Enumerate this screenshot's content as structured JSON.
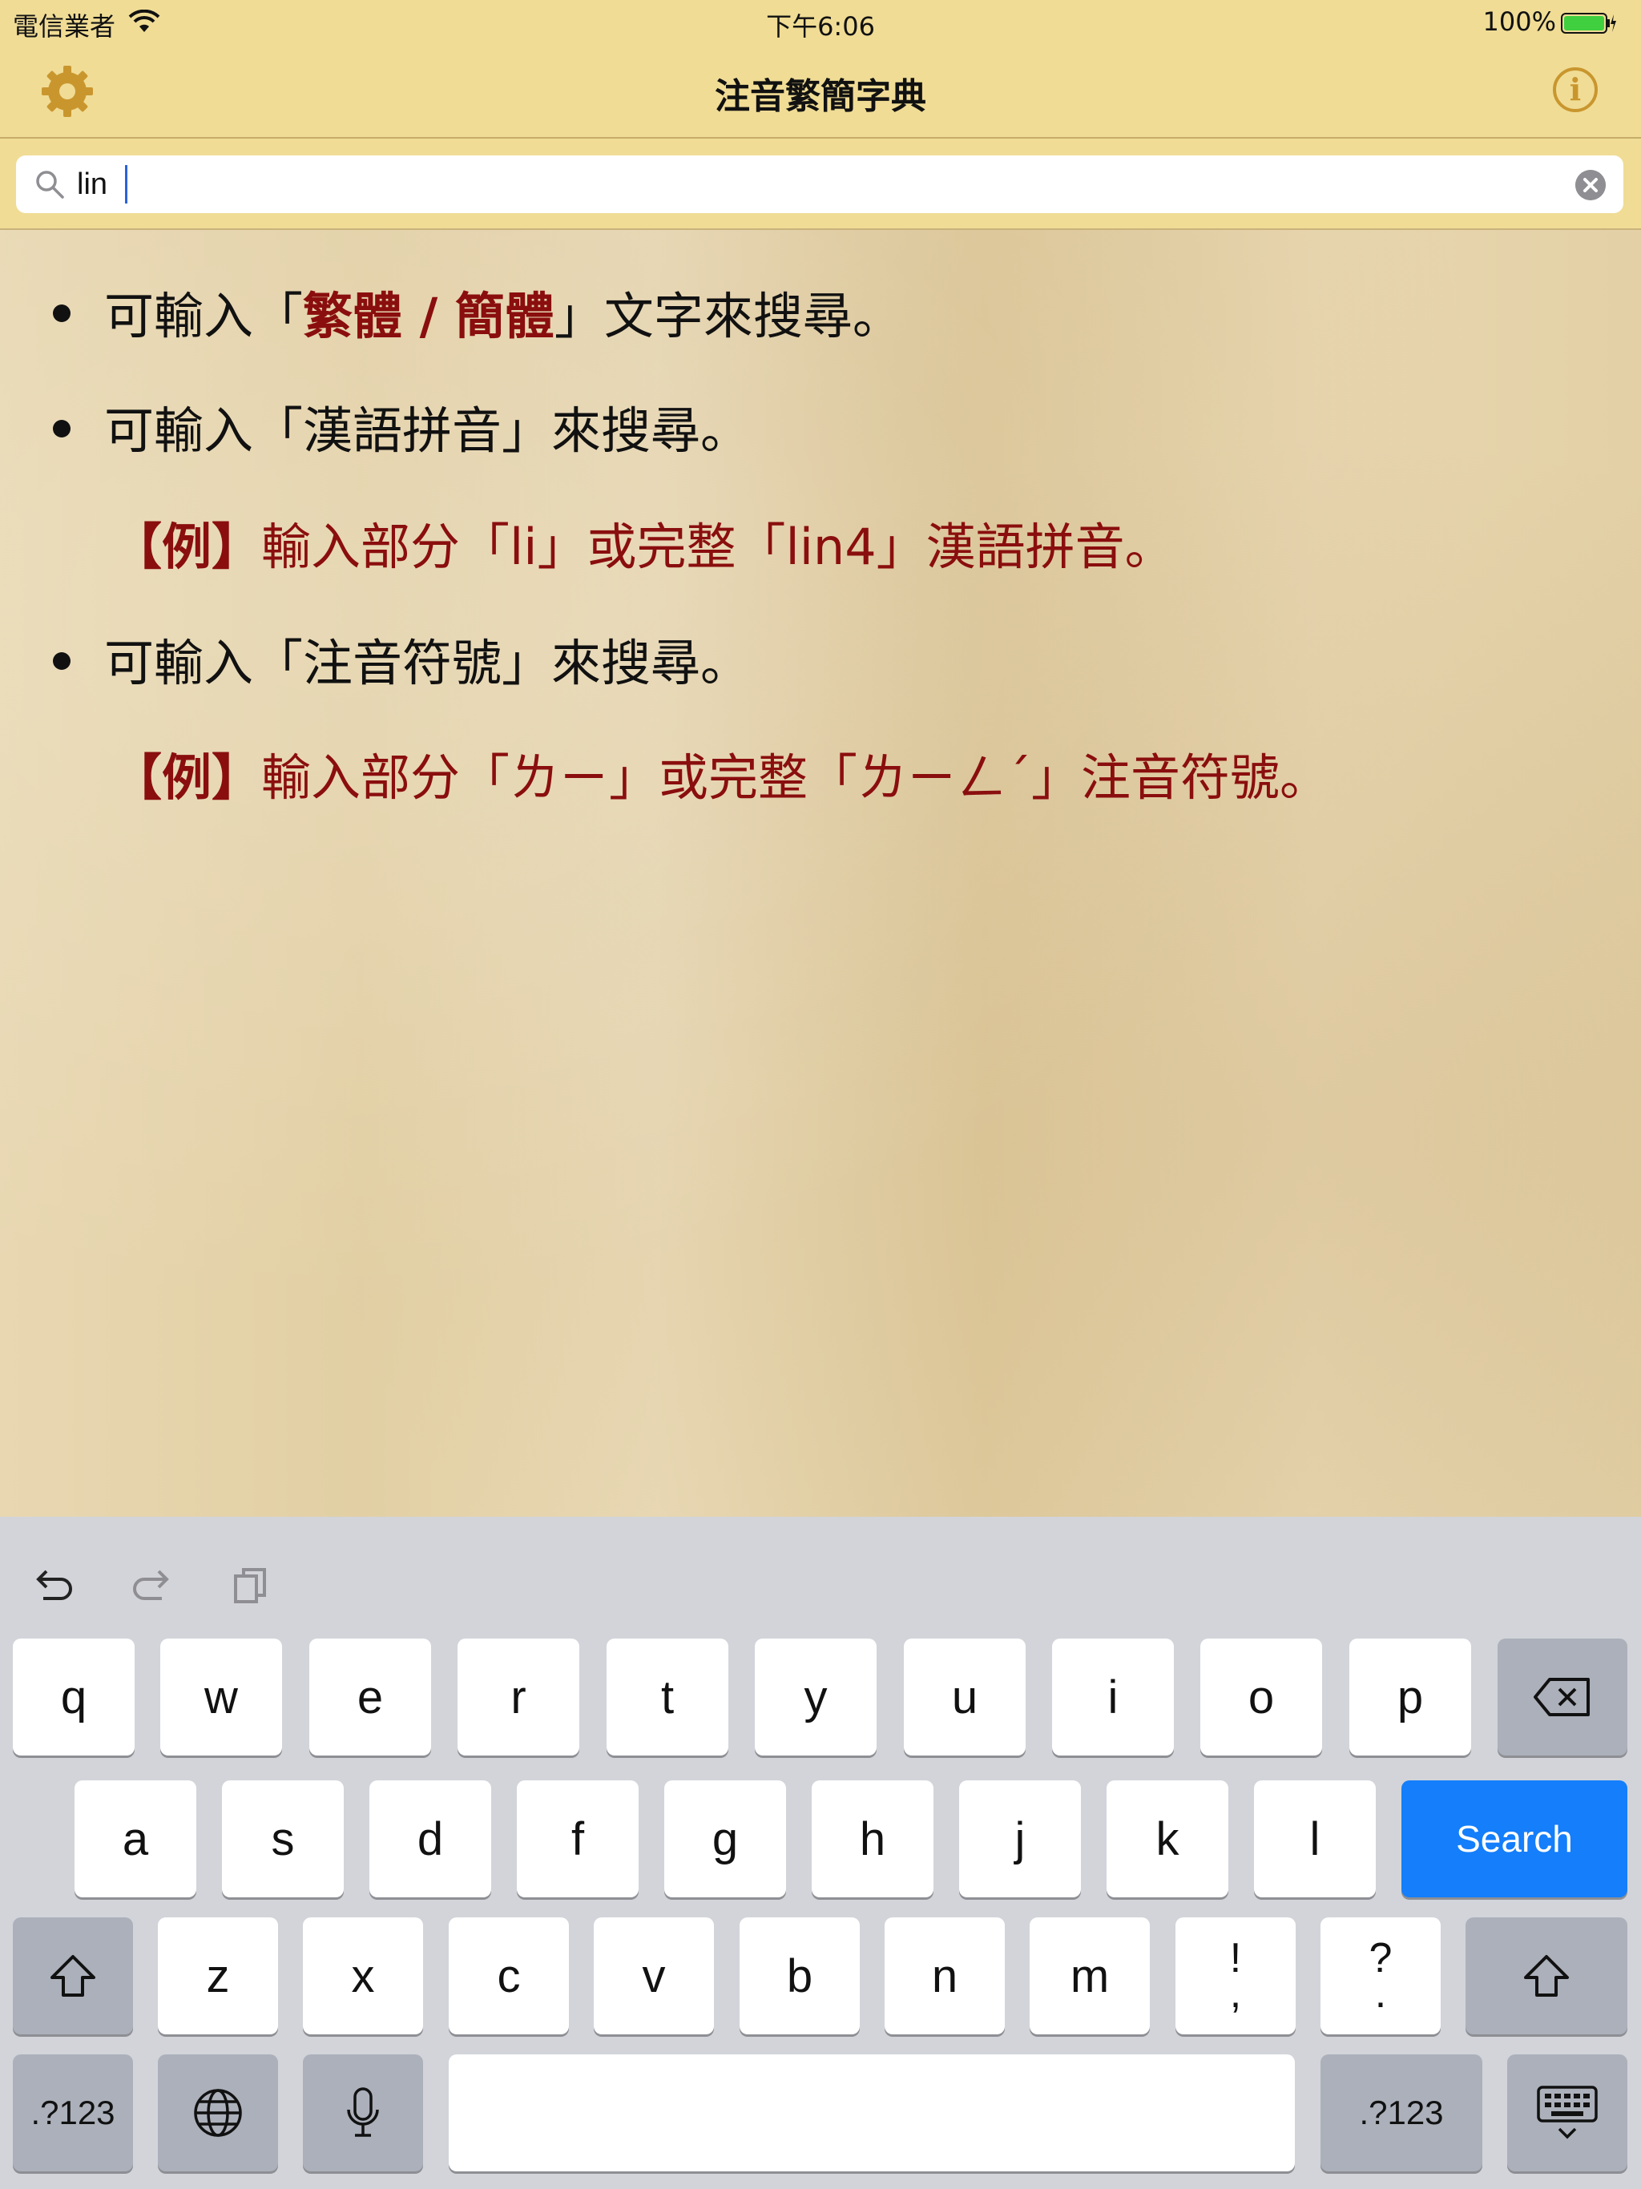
{
  "status_bar": {
    "carrier": "電信業者",
    "time": "下午6:06",
    "battery": "100%"
  },
  "nav": {
    "title": "注音繁簡字典",
    "info_label": "i"
  },
  "search": {
    "value": "lin"
  },
  "tips": {
    "tip1_prefix": "可輸入「",
    "tip1_highlight": "繁體 / 簡體",
    "tip1_suffix": "」文字來搜尋。",
    "tip2": "可輸入「漢語拼音」來搜尋。",
    "example1_tag": "【例】",
    "example1_text": "輸入部分「li」或完整「lin4」漢語拼音。",
    "tip3": "可輸入「注音符號」來搜尋。",
    "example2_tag": "【例】",
    "example2_text": "輸入部分「ㄌㄧ」或完整「ㄌㄧㄥˊ」注音符號。"
  },
  "keyboard": {
    "row1": [
      "q",
      "w",
      "e",
      "r",
      "t",
      "y",
      "u",
      "i",
      "o",
      "p"
    ],
    "row2": [
      "a",
      "s",
      "d",
      "f",
      "g",
      "h",
      "j",
      "k",
      "l"
    ],
    "row3": [
      "z",
      "x",
      "c",
      "v",
      "b",
      "n",
      "m"
    ],
    "punct1": {
      "top": "!",
      "bottom": ","
    },
    "punct2": {
      "top": "?",
      "bottom": "."
    },
    "search_label": "Search",
    "numbers_label": ".?123"
  },
  "colors": {
    "chrome": "#f0dc95",
    "accent_icon": "#c9962e",
    "highlight_text": "#8a0e0e",
    "search_key": "#147efb"
  }
}
